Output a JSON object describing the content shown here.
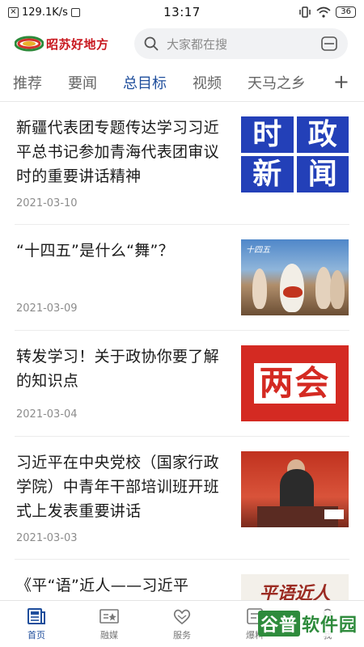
{
  "status_bar": {
    "speed": "129.1K/s",
    "time": "13:17",
    "battery": "36"
  },
  "header": {
    "logo_text": "昭苏好地方",
    "search_placeholder": "大家都在搜"
  },
  "tabs": [
    {
      "label": "推荐"
    },
    {
      "label": "要闻"
    },
    {
      "label": "总目标",
      "active": true
    },
    {
      "label": "视频"
    },
    {
      "label": "天马之乡"
    }
  ],
  "news": [
    {
      "title": "新疆代表团专题传达学习习近平总书记参加青海代表团审议时的重要讲话精神",
      "date": "2021-03-10",
      "thumb_text": [
        "时",
        "政",
        "新",
        "闻"
      ]
    },
    {
      "title": "“十四五”是什么“舞”？",
      "date": "2021-03-09",
      "thumb_caption": "十四五"
    },
    {
      "title": "转发学习！关于政协你要了解的知识点",
      "date": "2021-03-04",
      "thumb_text": "两会"
    },
    {
      "title": "习近平在中央党校（国家行政学院）中青年干部培训班开班式上发表重要讲话",
      "date": "2021-03-03"
    },
    {
      "title": "《平“语”近人——习近平",
      "thumb_text": "平语近人"
    }
  ],
  "bottom_nav": [
    {
      "label": "首页",
      "icon": "news-icon",
      "active": true
    },
    {
      "label": "融媒",
      "icon": "media-icon"
    },
    {
      "label": "服务",
      "icon": "heart-hands-icon"
    },
    {
      "label": "爆料",
      "icon": "report-icon"
    },
    {
      "label": "我",
      "icon": "user-icon"
    }
  ],
  "watermark": {
    "a": "谷普",
    "b": "软件园"
  },
  "colors": {
    "accent": "#1f4e9c",
    "logo_red": "#c8171e"
  }
}
